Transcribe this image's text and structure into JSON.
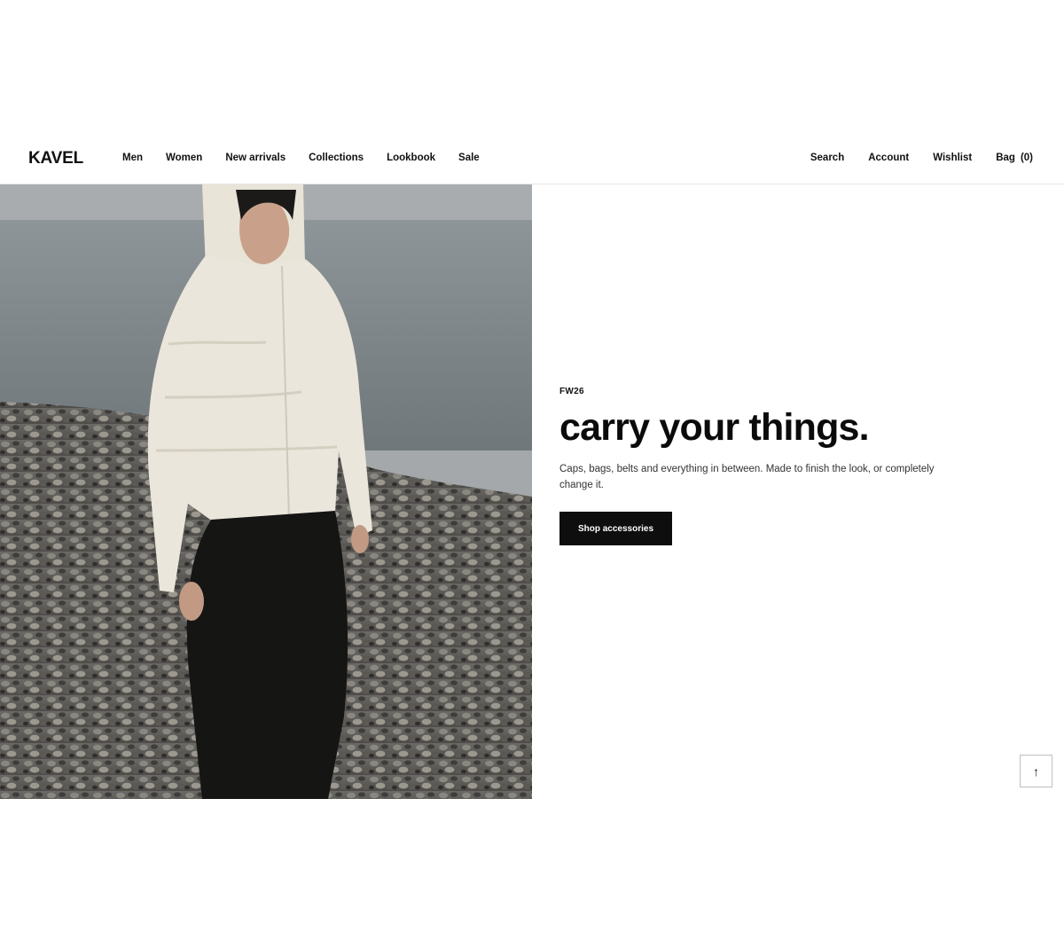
{
  "header": {
    "logo": "KAVEL",
    "nav_left": [
      "Men",
      "Women",
      "New arrivals",
      "Collections",
      "Lookbook",
      "Sale"
    ],
    "search_label": "Search",
    "account_label": "Account",
    "wishlist_label": "Wishlist",
    "bag_label": "Bag",
    "bag_count": "(0)"
  },
  "hero": {
    "eyebrow": "FW26",
    "headline": "carry your things.",
    "description": "Caps, bags, belts and everything in between. Made to finish the look, or completely change it.",
    "cta_label": "Shop accessories"
  },
  "back_to_top": {
    "icon": "arrow-up-icon",
    "glyph": "↑"
  },
  "colors": {
    "cta_bg": "#0e0e0e",
    "text": "#111111",
    "border": "#e6e6e6"
  }
}
